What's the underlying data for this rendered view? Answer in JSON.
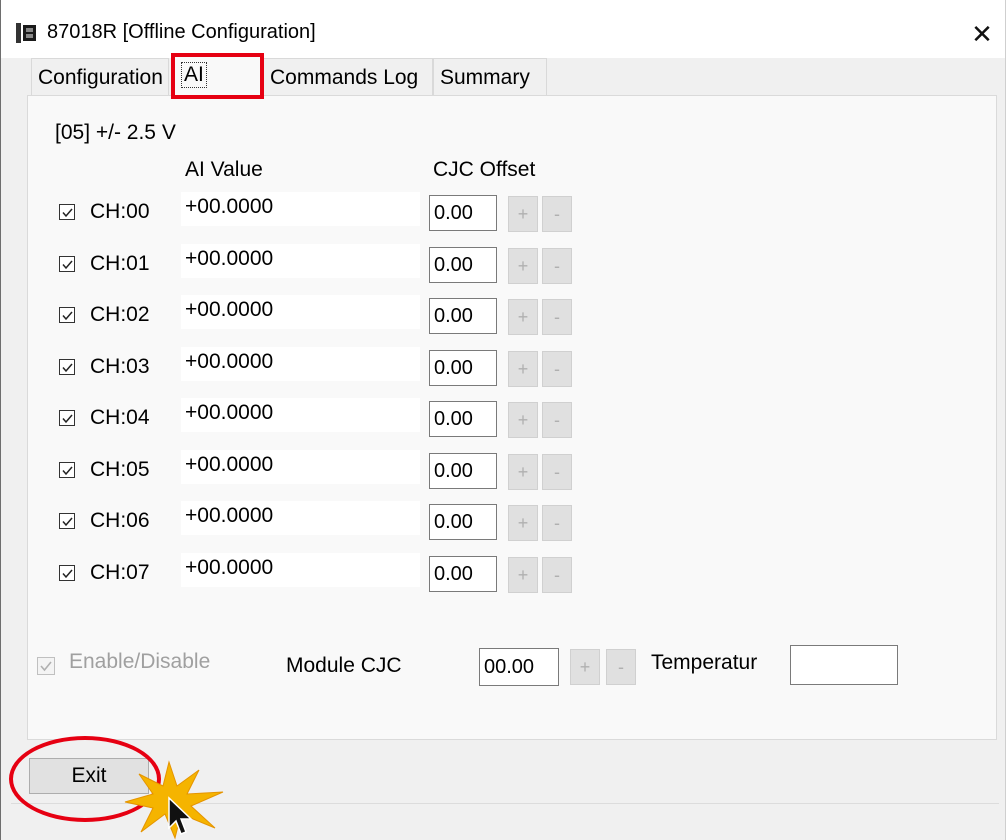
{
  "window": {
    "title": "87018R [Offline Configuration]",
    "close_glyph": "✕"
  },
  "tabs": [
    {
      "label": "Configuration"
    },
    {
      "label": "AI"
    },
    {
      "label": "Commands Log"
    },
    {
      "label": "Summary"
    }
  ],
  "active_tab": "AI",
  "ai": {
    "range": "[05] +/- 2.5 V",
    "header_value": "AI Value",
    "header_cjc": "CJC Offset",
    "plus": "+",
    "minus": "-",
    "channels": [
      {
        "label": "CH:00",
        "checked": true,
        "value": "+00.0000",
        "cjc": "0.00"
      },
      {
        "label": "CH:01",
        "checked": true,
        "value": "+00.0000",
        "cjc": "0.00"
      },
      {
        "label": "CH:02",
        "checked": true,
        "value": "+00.0000",
        "cjc": "0.00"
      },
      {
        "label": "CH:03",
        "checked": true,
        "value": "+00.0000",
        "cjc": "0.00"
      },
      {
        "label": "CH:04",
        "checked": true,
        "value": "+00.0000",
        "cjc": "0.00"
      },
      {
        "label": "CH:05",
        "checked": true,
        "value": "+00.0000",
        "cjc": "0.00"
      },
      {
        "label": "CH:06",
        "checked": true,
        "value": "+00.0000",
        "cjc": "0.00"
      },
      {
        "label": "CH:07",
        "checked": true,
        "value": "+00.0000",
        "cjc": "0.00"
      }
    ],
    "enable_label": "Enable/Disable",
    "enable_checked": true,
    "module_cjc_label": "Module CJC",
    "module_cjc_value": "00.00",
    "temperature_label": "Temperatur",
    "temperature_value": ""
  },
  "footer": {
    "exit_label": "Exit"
  },
  "colors": {
    "highlight": "#e60012",
    "starburst": "#f5b400"
  }
}
